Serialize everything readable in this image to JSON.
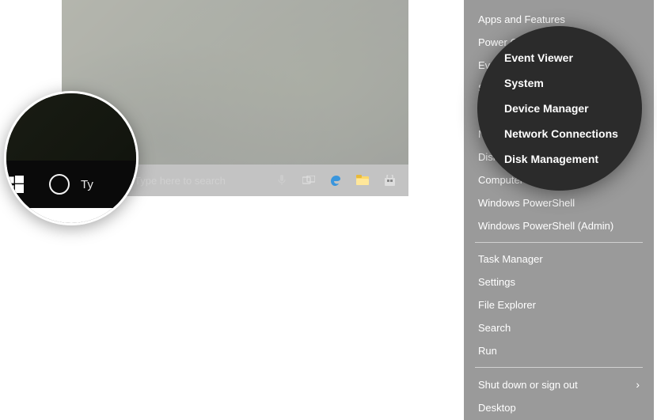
{
  "taskbar": {
    "search_placeholder": "Type here to search"
  },
  "magnifier_left": {
    "search_fragment": "Ty"
  },
  "power_menu": {
    "group1": [
      "Apps and Features",
      "Power Options",
      "Event Viewer",
      "System",
      "Device Manager",
      "Network Connections",
      "Disk Management",
      "Computer Management",
      "Windows PowerShell",
      "Windows PowerShell (Admin)"
    ],
    "group2": [
      "Task Manager",
      "Settings",
      "File Explorer",
      "Search",
      "Run"
    ],
    "group3": [
      {
        "label": "Shut down or sign out",
        "submenu": true
      },
      {
        "label": "Desktop",
        "submenu": false
      }
    ]
  },
  "magnifier_right": {
    "items": [
      "Event Viewer",
      "System",
      "Device Manager",
      "Network Connections",
      "Disk Management"
    ]
  },
  "colors": {
    "menu_bg": "#9a9a9a",
    "menu_text": "#ffffff",
    "mag_bg": "#2b2b2b"
  }
}
